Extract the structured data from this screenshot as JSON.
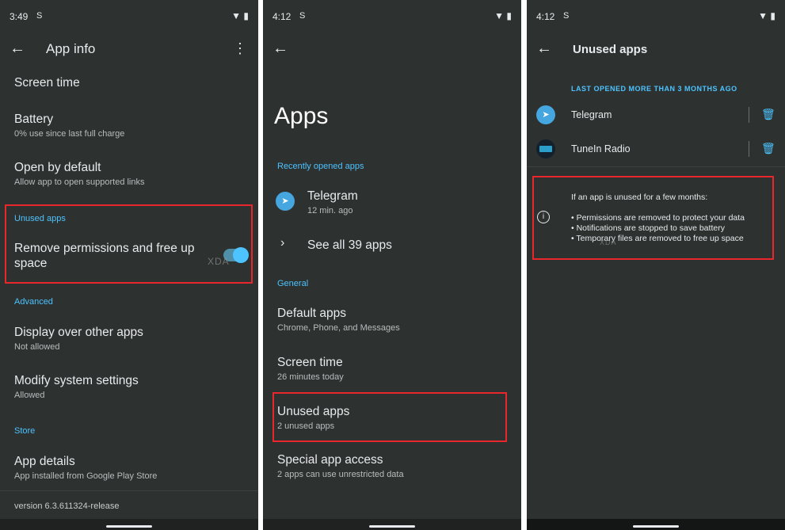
{
  "panel1": {
    "status": {
      "time": "3:49",
      "left_icon": "S",
      "right_icons": "▼ ▮"
    },
    "toolbar": {
      "title": "App info"
    },
    "items": [
      {
        "title": "Screen time",
        "subtitle": ""
      },
      {
        "title": "Battery",
        "subtitle": "0% use since last full charge"
      },
      {
        "title": "Open by default",
        "subtitle": "Allow app to open supported links"
      }
    ],
    "unused_header": "Unused apps",
    "remove_permissions": "Remove permissions and free up space",
    "advanced_header": "Advanced",
    "advanced_items": [
      {
        "title": "Display over other apps",
        "subtitle": "Not allowed"
      },
      {
        "title": "Modify system settings",
        "subtitle": "Allowed"
      }
    ],
    "store_header": "Store",
    "app_details": {
      "title": "App details",
      "subtitle": "App installed from Google Play Store"
    },
    "version": "version 6.3.611324-release"
  },
  "panel2": {
    "status": {
      "time": "4:12",
      "left_icon": "S",
      "right_icons": "▼ ▮"
    },
    "title": "Apps",
    "recent_header": "Recently opened apps",
    "recent_app": {
      "title": "Telegram",
      "subtitle": "12 min. ago"
    },
    "see_all": "See all 39 apps",
    "general_header": "General",
    "items": [
      {
        "title": "Default apps",
        "subtitle": "Chrome, Phone, and Messages"
      },
      {
        "title": "Screen time",
        "subtitle": "26 minutes today"
      },
      {
        "title": "Unused apps",
        "subtitle": "2 unused apps"
      },
      {
        "title": "Special app access",
        "subtitle": "2 apps can use unrestricted data"
      }
    ]
  },
  "panel3": {
    "status": {
      "time": "4:12",
      "left_icon": "S",
      "right_icons": "▼ ▮"
    },
    "toolbar": {
      "title": "Unused apps"
    },
    "section_header": "LAST OPENED MORE THAN 3 MONTHS AGO",
    "apps": [
      {
        "name": "Telegram"
      },
      {
        "name": "TuneIn Radio"
      }
    ],
    "info_intro": "If an app is unused for a few months:",
    "info_bullets": [
      "• Permissions are removed to protect your data",
      "• Notifications are stopped to save battery",
      "• Temporary files are removed to free up space"
    ]
  },
  "watermark": "XDA",
  "colors": {
    "background": "#2d312f",
    "accent": "#4dc3ff",
    "highlight": "#e8262b"
  }
}
